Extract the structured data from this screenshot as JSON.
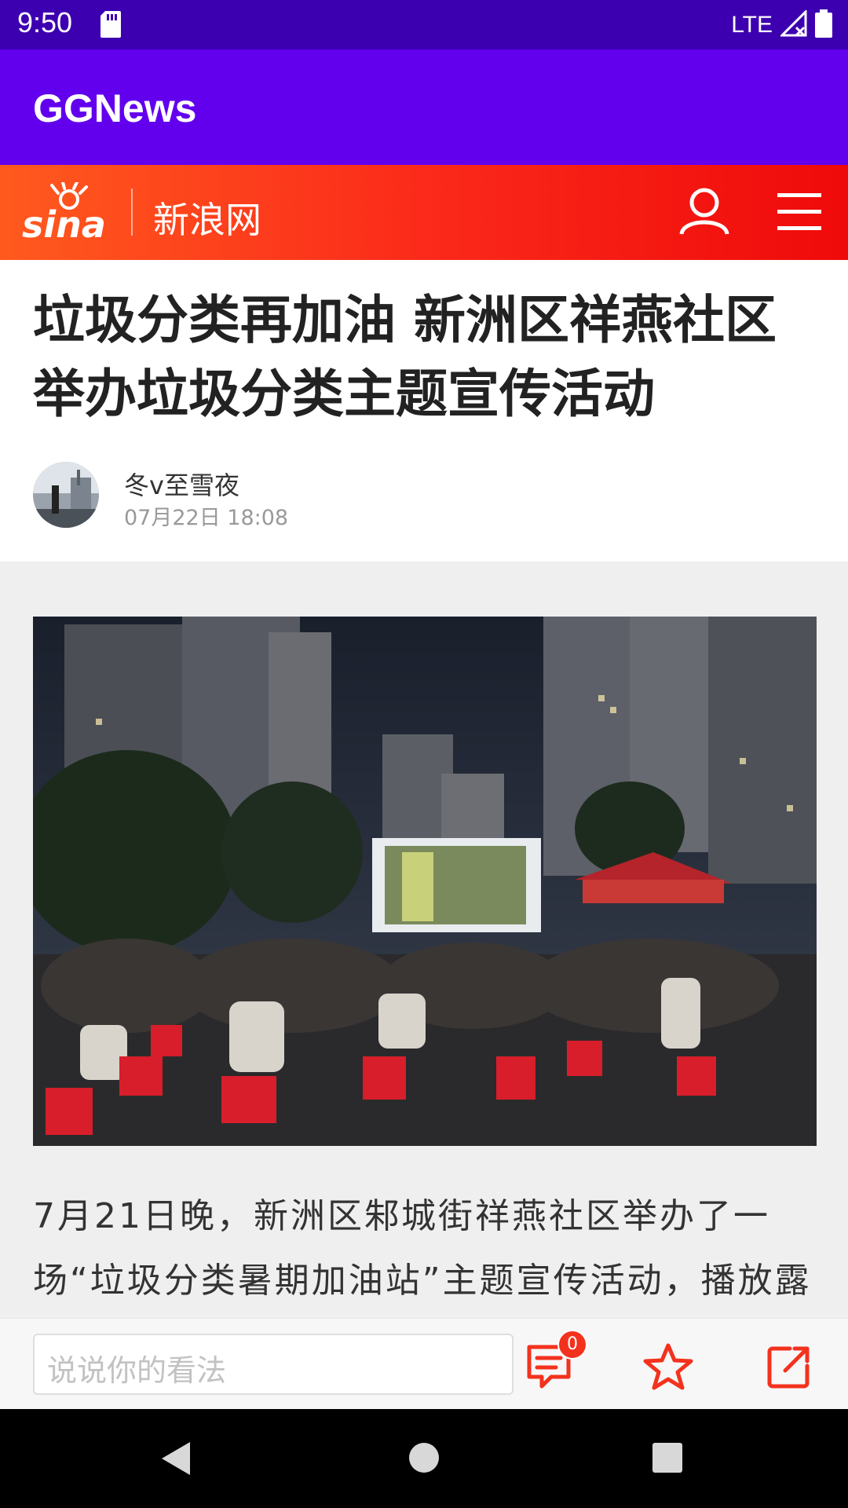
{
  "status_bar": {
    "time": "9:50",
    "network": "LTE"
  },
  "app_bar": {
    "title": "GGNews"
  },
  "sina_header": {
    "logo_text": "sina",
    "site_name": "新浪网"
  },
  "article": {
    "title": "垃圾分类再加油 新洲区祥燕社区举办垃圾分类主题宣传活动",
    "author": "冬v至雪夜",
    "date": "07月22日  18:08",
    "body": "7月21日晚，新洲区邾城街祥燕社区举办了一场“垃圾分类暑期加油站”主题宣传活动，播放露"
  },
  "comment_bar": {
    "placeholder": "说说你的看法",
    "comment_count": "0"
  },
  "icons": {
    "user": "user-icon",
    "menu": "menu-icon",
    "comments": "comment-icon",
    "favorite": "star-icon",
    "share": "share-icon"
  },
  "colors": {
    "status_bar": "#3d00b0",
    "app_bar": "#6200ee",
    "sina_red": "#f3321e",
    "badge": "#f3321e"
  }
}
